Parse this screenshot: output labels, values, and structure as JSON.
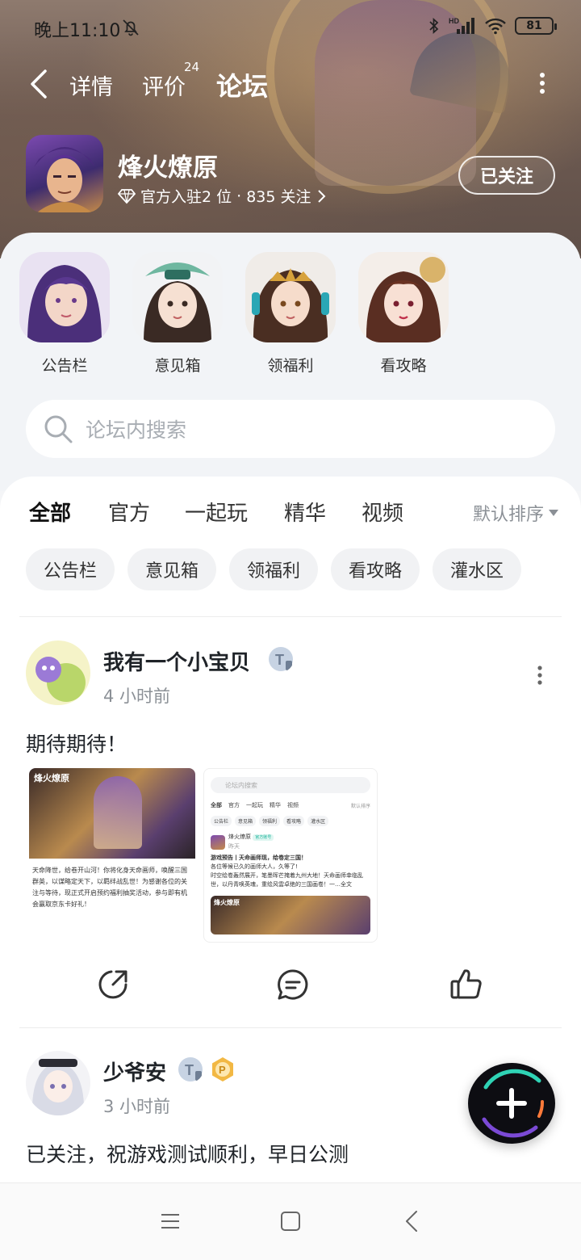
{
  "status_bar": {
    "time": "晚上11:10",
    "battery": "81",
    "icons": [
      "mute-bell-icon",
      "bluetooth-icon",
      "hd-signal-icon",
      "wifi-icon",
      "battery-icon"
    ]
  },
  "nav": {
    "tabs": [
      {
        "label": "详情",
        "active": false
      },
      {
        "label": "评价",
        "active": false,
        "badge": "24"
      },
      {
        "label": "论坛",
        "active": true
      }
    ],
    "accent_color": "#2fd3b5"
  },
  "game": {
    "title": "烽火燎原",
    "meta_official": "官方入驻2 位",
    "meta_sep": "·",
    "meta_followers": "835 关注",
    "follow_label": "已关注"
  },
  "quick_links": [
    {
      "label": "公告栏",
      "icon": "character-avatar-purple"
    },
    {
      "label": "意见箱",
      "icon": "character-avatar-green-hat"
    },
    {
      "label": "领福利",
      "icon": "character-avatar-gold-crown"
    },
    {
      "label": "看攻略",
      "icon": "character-avatar-red"
    }
  ],
  "search": {
    "placeholder": "论坛内搜索"
  },
  "filters": {
    "tabs": [
      {
        "label": "全部",
        "active": true
      },
      {
        "label": "官方",
        "active": false
      },
      {
        "label": "一起玩",
        "active": false
      },
      {
        "label": "精华",
        "active": false
      },
      {
        "label": "视频",
        "active": false
      }
    ],
    "sort_label": "默认排序"
  },
  "chips": [
    "公告栏",
    "意见箱",
    "领福利",
    "看攻略",
    "灌水区"
  ],
  "posts": [
    {
      "username": "我有一个小宝贝",
      "time": "4 小时前",
      "text": "期待期待！",
      "images": {
        "img1_logo": "烽火燎原",
        "img1_text": "天命降世，给卷开山河！你将化身天命画师，唤醒三国群英，以谋略定天下，以羁绊战乱世！为感谢各位的关注与等待，现正式开启预约福利抽奖活动，参与即有机会赢取京东卡好礼！",
        "img2_search": "论坛内搜索",
        "img2_tabs": [
          "全部",
          "官方",
          "一起玩",
          "精华",
          "视频"
        ],
        "img2_sort": "默认排序",
        "img2_chips": [
          "公告栏",
          "意见箱",
          "领福利",
          "看攻略",
          "灌水区"
        ],
        "img2_user": "烽火燎原",
        "img2_tag": "官方账号",
        "img2_time": "昨天",
        "img2_title": "游戏预告丨天命画师现，给卷定三国！",
        "img2_line1": "各位等候已久的画师大人，久等了!",
        "img2_line2": "时空绘卷轰然展开，笔墨晖芒掩着九州大地！天命画师幸临乱世，以丹青唤英魂，重绘风雲卓绝的三国画卷！一…全文",
        "img2_logo": "烽火燎原"
      }
    },
    {
      "username": "少爷安",
      "time": "3 小时前",
      "text": "已关注，祝游戏测试顺利，早日公测"
    }
  ]
}
